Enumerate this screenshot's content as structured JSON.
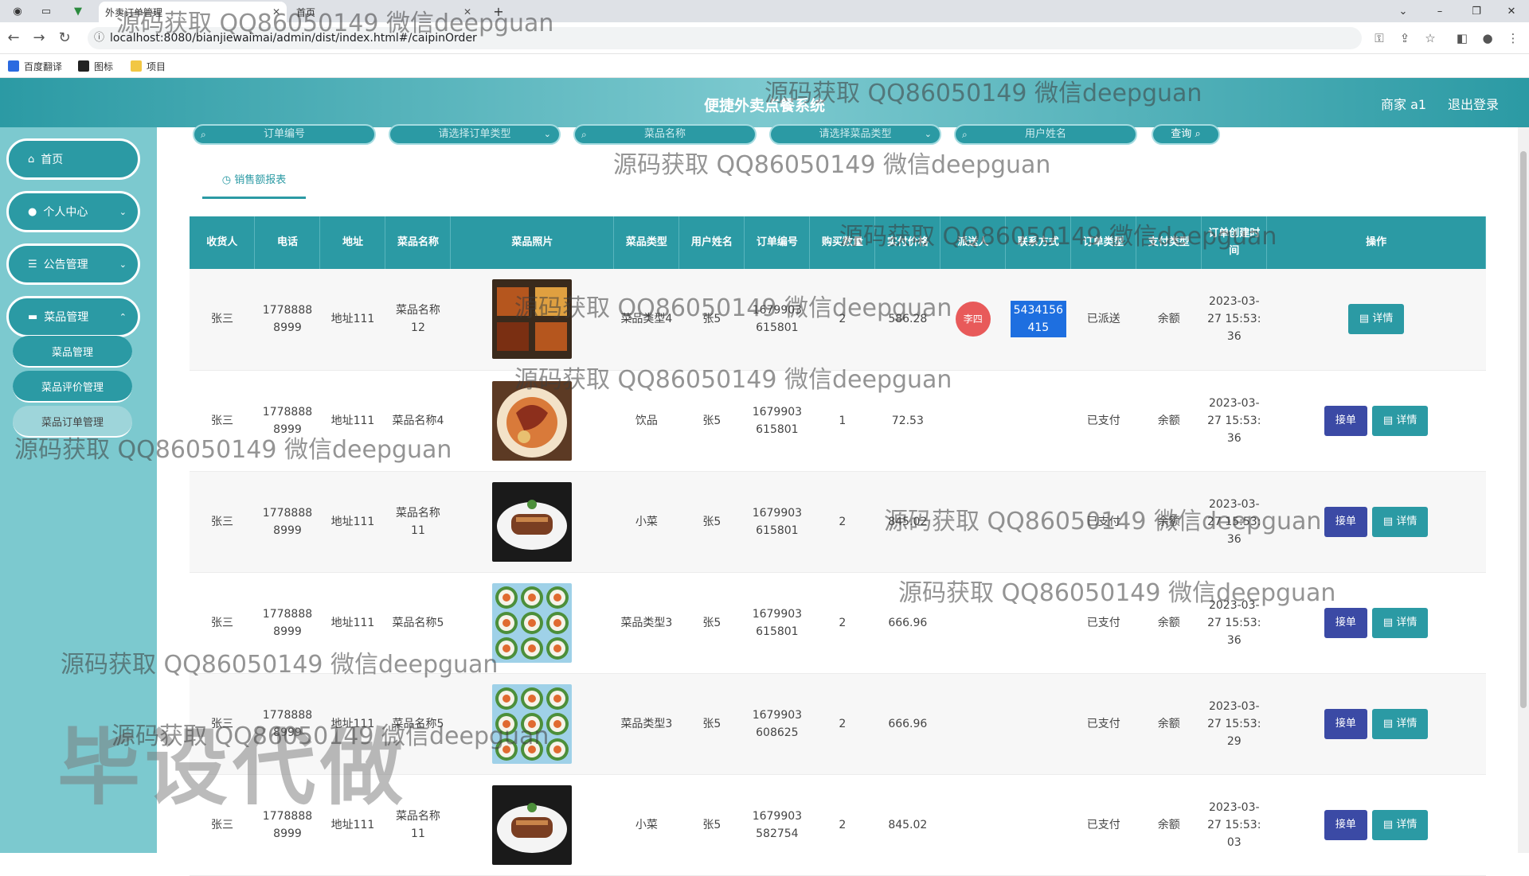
{
  "browser": {
    "tabs": [
      {
        "title": "外卖订单管理",
        "active": true
      },
      {
        "title": "首页",
        "active": false
      }
    ],
    "new_tab": "+",
    "url": "localhost:8080/bianjiewaimai/admin/dist/index.html#/caipinOrder",
    "bookmarks": [
      "百度翻译",
      "图标",
      "项目"
    ]
  },
  "header": {
    "title": "便捷外卖点餐系统",
    "user": "商家 a1",
    "logout": "退出登录"
  },
  "sidebar": {
    "items": [
      {
        "label": "首页",
        "icon": "home-icon"
      },
      {
        "label": "个人中心",
        "icon": "user-icon"
      },
      {
        "label": "公告管理",
        "icon": "list-icon"
      },
      {
        "label": "菜品管理",
        "icon": "monitor-icon"
      }
    ],
    "sub_items": [
      "菜品管理",
      "菜品评价管理",
      "菜品订单管理"
    ]
  },
  "search": {
    "order_no": "订单编号",
    "order_type": "请选择订单类型",
    "dish_name": "菜品名称",
    "dish_type": "请选择菜品类型",
    "user_name": "用户姓名",
    "query": "查询"
  },
  "report_tab": "销售额报表",
  "table": {
    "headers": [
      "收货人",
      "电话",
      "地址",
      "菜品名称",
      "菜品照片",
      "菜品类型",
      "用户姓名",
      "订单编号",
      "购买数量",
      "实付价格",
      "派送人",
      "联系方式",
      "订单类型",
      "支付类型",
      "订单创建时间",
      "操作"
    ],
    "accept_label": "接单",
    "detail_label": "详情",
    "rows": [
      {
        "receiver": "张三",
        "phone": "17788888999",
        "address": "地址111",
        "dish": "菜品名称12",
        "dish_type": "菜品类型4",
        "user": "张5",
        "order_no": "1679903615801",
        "qty": "2",
        "price": "586.28",
        "courier": "李四",
        "contact": "5434156415",
        "order_type": "已派送",
        "pay_type": "余额",
        "time": "2023-03-27 15:53:36",
        "can_accept": false,
        "photo": "bbq"
      },
      {
        "receiver": "张三",
        "phone": "17788888999",
        "address": "地址111",
        "dish": "菜品名称4",
        "dish_type": "饮品",
        "user": "张5",
        "order_no": "1679903615801",
        "qty": "1",
        "price": "72.53",
        "courier": "",
        "contact": "",
        "order_type": "已支付",
        "pay_type": "余额",
        "time": "2023-03-27 15:53:36",
        "can_accept": true,
        "photo": "seafood"
      },
      {
        "receiver": "张三",
        "phone": "17788888999",
        "address": "地址111",
        "dish": "菜品名称11",
        "dish_type": "小菜",
        "user": "张5",
        "order_no": "1679903615801",
        "qty": "2",
        "price": "845.02",
        "courier": "",
        "contact": "",
        "order_type": "已支付",
        "pay_type": "余额",
        "time": "2023-03-27 15:53:36",
        "can_accept": true,
        "photo": "roll"
      },
      {
        "receiver": "张三",
        "phone": "17788888999",
        "address": "地址111",
        "dish": "菜品名称5",
        "dish_type": "菜品类型3",
        "user": "张5",
        "order_no": "1679903615801",
        "qty": "2",
        "price": "666.96",
        "courier": "",
        "contact": "",
        "order_type": "已支付",
        "pay_type": "余额",
        "time": "2023-03-27 15:53:36",
        "can_accept": true,
        "photo": "sushi"
      },
      {
        "receiver": "张三",
        "phone": "17788888999",
        "address": "地址111",
        "dish": "菜品名称5",
        "dish_type": "菜品类型3",
        "user": "张5",
        "order_no": "1679903608625",
        "qty": "2",
        "price": "666.96",
        "courier": "",
        "contact": "",
        "order_type": "已支付",
        "pay_type": "余额",
        "time": "2023-03-27 15:53:29",
        "can_accept": true,
        "photo": "sushi"
      },
      {
        "receiver": "张三",
        "phone": "17788888999",
        "address": "地址111",
        "dish": "菜品名称11",
        "dish_type": "小菜",
        "user": "张5",
        "order_no": "1679903582754",
        "qty": "2",
        "price": "845.02",
        "courier": "",
        "contact": "",
        "order_type": "已支付",
        "pay_type": "余额",
        "time": "2023-03-27 15:53:03",
        "can_accept": true,
        "photo": "roll"
      }
    ]
  },
  "watermark": "源码获取 QQ86050149 微信deepguan",
  "big_watermark": "毕设代做",
  "colors": {
    "primary": "#2b9aa4",
    "light": "#7cc9cf",
    "accept": "#3b4aa5"
  }
}
